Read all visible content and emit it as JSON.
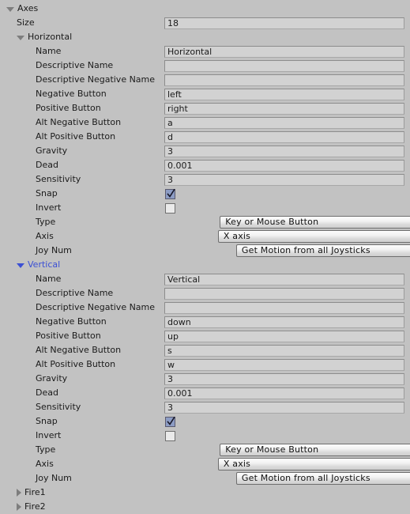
{
  "window": {
    "title": "Input Manager Axes",
    "background_color": "#c2c2c2",
    "accent_color": "#3b4fd4",
    "field_color": "#d2d2d2"
  },
  "root": {
    "label": "Axes",
    "expanded": true,
    "triangle": "triangle-down-icon"
  },
  "size_row": {
    "label": "Size",
    "value": "18"
  },
  "axes": [
    {
      "name": "Horizontal",
      "expanded": true,
      "selected": false,
      "triangle": "triangle-down-icon",
      "fields": [
        {
          "kind": "text",
          "label": "Name",
          "value": "Horizontal"
        },
        {
          "kind": "text",
          "label": "Descriptive Name",
          "value": ""
        },
        {
          "kind": "text",
          "label": "Descriptive Negative Name",
          "value": ""
        },
        {
          "kind": "text",
          "label": "Negative Button",
          "value": "left"
        },
        {
          "kind": "text",
          "label": "Positive Button",
          "value": "right"
        },
        {
          "kind": "text",
          "label": "Alt Negative Button",
          "value": "a"
        },
        {
          "kind": "text",
          "label": "Alt Positive Button",
          "value": "d"
        },
        {
          "kind": "text",
          "label": "Gravity",
          "value": "3"
        },
        {
          "kind": "text",
          "label": "Dead",
          "value": "0.001"
        },
        {
          "kind": "text",
          "label": "Sensitivity",
          "value": "3"
        },
        {
          "kind": "checkbox",
          "label": "Snap",
          "value": true
        },
        {
          "kind": "checkbox",
          "label": "Invert",
          "value": false
        },
        {
          "kind": "dropdown",
          "label": "Type",
          "value": "Key or Mouse Button"
        },
        {
          "kind": "dropdown",
          "label": "Axis",
          "value": "X axis"
        },
        {
          "kind": "dropdown",
          "label": "Joy Num",
          "value": "Get Motion from all Joysticks"
        }
      ]
    },
    {
      "name": "Vertical",
      "expanded": true,
      "selected": true,
      "triangle": "triangle-down-icon",
      "fields": [
        {
          "kind": "text",
          "label": "Name",
          "value": "Vertical"
        },
        {
          "kind": "text",
          "label": "Descriptive Name",
          "value": ""
        },
        {
          "kind": "text",
          "label": "Descriptive Negative Name",
          "value": ""
        },
        {
          "kind": "text",
          "label": "Negative Button",
          "value": "down"
        },
        {
          "kind": "text",
          "label": "Positive Button",
          "value": "up"
        },
        {
          "kind": "text",
          "label": "Alt Negative Button",
          "value": "s"
        },
        {
          "kind": "text",
          "label": "Alt Positive Button",
          "value": "w"
        },
        {
          "kind": "text",
          "label": "Gravity",
          "value": "3"
        },
        {
          "kind": "text",
          "label": "Dead",
          "value": "0.001"
        },
        {
          "kind": "text",
          "label": "Sensitivity",
          "value": "3"
        },
        {
          "kind": "checkbox",
          "label": "Snap",
          "value": true
        },
        {
          "kind": "checkbox",
          "label": "Invert",
          "value": false
        },
        {
          "kind": "dropdown",
          "label": "Type",
          "value": "Key or Mouse Button"
        },
        {
          "kind": "dropdown",
          "label": "Axis",
          "value": "X axis"
        },
        {
          "kind": "dropdown",
          "label": "Joy Num",
          "value": "Get Motion from all Joysticks"
        }
      ]
    },
    {
      "name": "Fire1",
      "expanded": false,
      "selected": false,
      "triangle": "triangle-right-icon",
      "fields": []
    },
    {
      "name": "Fire2",
      "expanded": false,
      "selected": false,
      "triangle": "triangle-right-icon",
      "fields": []
    }
  ]
}
